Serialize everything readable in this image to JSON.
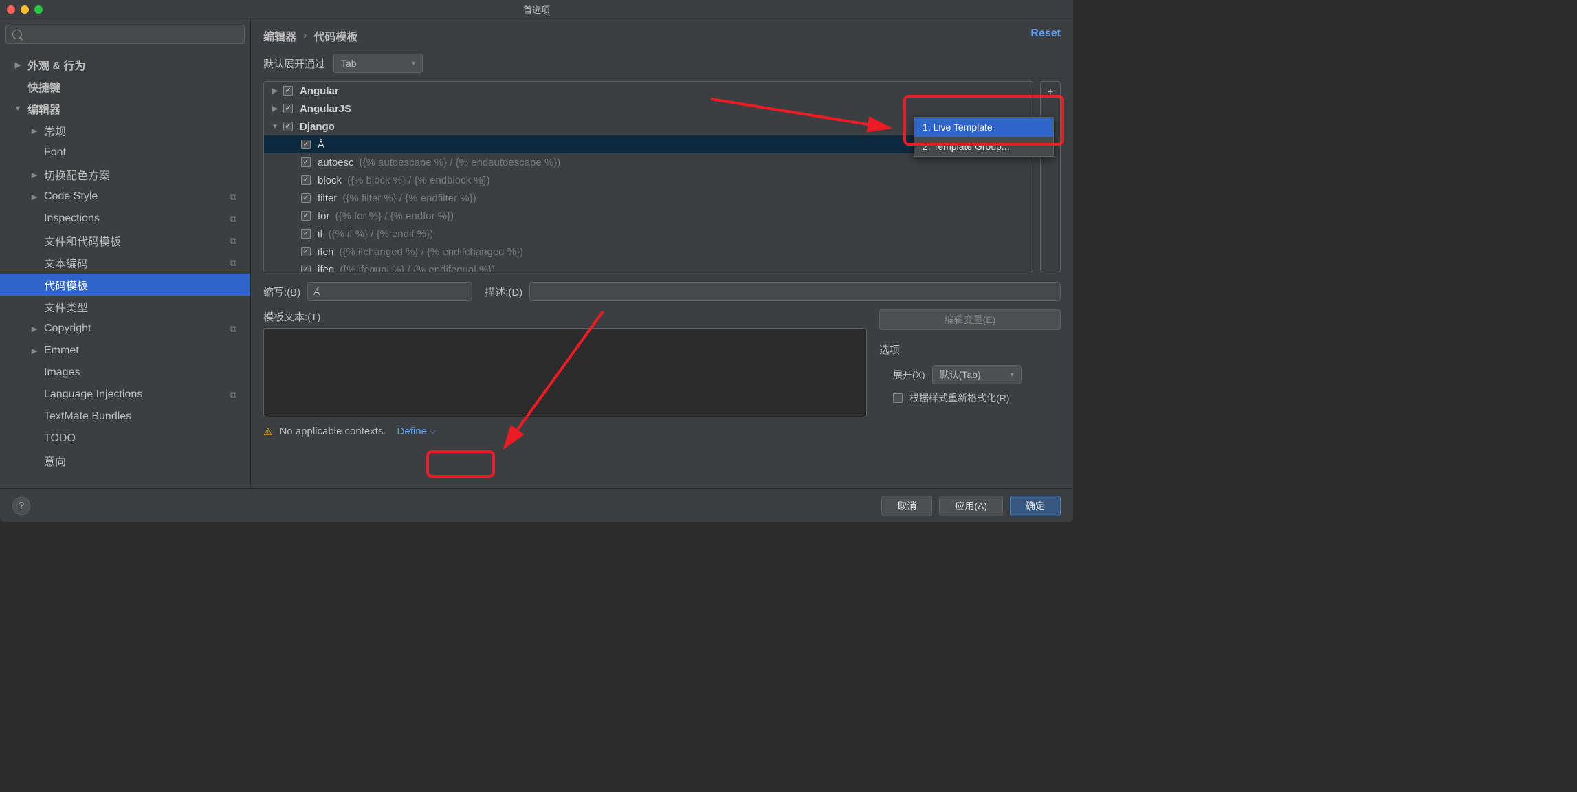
{
  "window": {
    "title": "首选项"
  },
  "sidebar": {
    "items": [
      {
        "label": "外观 & 行为",
        "arrow": "right",
        "bold": true,
        "level": 0,
        "copy": false
      },
      {
        "label": "快捷键",
        "arrow": "none",
        "bold": true,
        "level": 0,
        "copy": false
      },
      {
        "label": "编辑器",
        "arrow": "down",
        "bold": true,
        "level": 0,
        "copy": false
      },
      {
        "label": "常规",
        "arrow": "right",
        "bold": false,
        "level": 1,
        "copy": false
      },
      {
        "label": "Font",
        "arrow": "none",
        "bold": false,
        "level": 1,
        "copy": false
      },
      {
        "label": "切换配色方案",
        "arrow": "right",
        "bold": false,
        "level": 1,
        "copy": false
      },
      {
        "label": "Code Style",
        "arrow": "right",
        "bold": false,
        "level": 1,
        "copy": true
      },
      {
        "label": "Inspections",
        "arrow": "none",
        "bold": false,
        "level": 1,
        "copy": true
      },
      {
        "label": "文件和代码模板",
        "arrow": "none",
        "bold": false,
        "level": 1,
        "copy": true
      },
      {
        "label": "文本编码",
        "arrow": "none",
        "bold": false,
        "level": 1,
        "copy": true
      },
      {
        "label": "代码模板",
        "arrow": "none",
        "bold": false,
        "level": 1,
        "copy": false,
        "selected": true
      },
      {
        "label": "文件类型",
        "arrow": "none",
        "bold": false,
        "level": 1,
        "copy": false
      },
      {
        "label": "Copyright",
        "arrow": "right",
        "bold": false,
        "level": 1,
        "copy": true
      },
      {
        "label": "Emmet",
        "arrow": "right",
        "bold": false,
        "level": 1,
        "copy": false
      },
      {
        "label": "Images",
        "arrow": "none",
        "bold": false,
        "level": 1,
        "copy": false
      },
      {
        "label": "Language Injections",
        "arrow": "none",
        "bold": false,
        "level": 1,
        "copy": true
      },
      {
        "label": "TextMate Bundles",
        "arrow": "none",
        "bold": false,
        "level": 1,
        "copy": false
      },
      {
        "label": "TODO",
        "arrow": "none",
        "bold": false,
        "level": 1,
        "copy": false
      },
      {
        "label": "意向",
        "arrow": "none",
        "bold": false,
        "level": 1,
        "copy": false
      }
    ]
  },
  "breadcrumb": {
    "root": "编辑器",
    "current": "代码模板"
  },
  "reset": "Reset",
  "expand": {
    "label": "默认展开通过",
    "value": "Tab"
  },
  "templates": {
    "groups": [
      {
        "name": "Angular",
        "open": false,
        "items": []
      },
      {
        "name": "AngularJS",
        "open": false,
        "items": []
      },
      {
        "name": "Django",
        "open": true,
        "items": [
          {
            "name": "Å",
            "desc": "",
            "selected": true
          },
          {
            "name": "autoesc",
            "desc": "({% autoescape %} / {% endautoescape %})"
          },
          {
            "name": "block",
            "desc": "({% block %} / {% endblock %})"
          },
          {
            "name": "filter",
            "desc": "({% filter %} / {% endfilter %})"
          },
          {
            "name": "for",
            "desc": "({% for %} / {% endfor %})"
          },
          {
            "name": "if",
            "desc": "({% if %} / {% endif %})"
          },
          {
            "name": "ifch",
            "desc": "({% ifchanged %} / {% endifchanged %})"
          },
          {
            "name": "ifeq",
            "desc": "({% ifequal %} / {% endifequal %})"
          }
        ]
      }
    ]
  },
  "toolbar": {
    "add": "+"
  },
  "popup": {
    "items": [
      {
        "label": "1. Live Template",
        "hover": true
      },
      {
        "label": "2. Template Group..."
      }
    ]
  },
  "form": {
    "abbr_label": "缩写:(B)",
    "abbr_value": "Å",
    "desc_label": "描述:(D)",
    "desc_value": "",
    "template_label": "模板文本:(T)",
    "edit_vars": "编辑变量(E)",
    "options_title": "选项",
    "expand_label": "展开(X)",
    "expand_value": "默认(Tab)",
    "reformat_label": "根据样式重新格式化(R)",
    "context_warn": "No applicable contexts.",
    "define": "Define"
  },
  "footer": {
    "cancel": "取消",
    "apply": "应用(A)",
    "ok": "确定"
  }
}
